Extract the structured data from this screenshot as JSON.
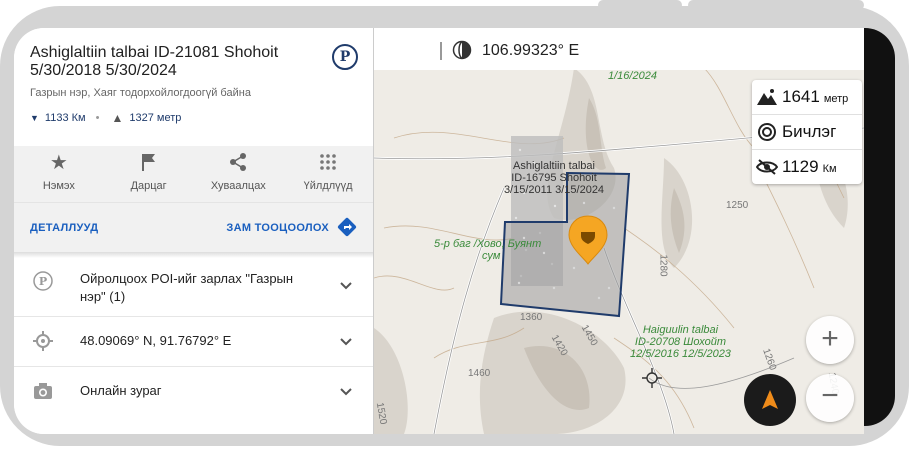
{
  "poi": {
    "title": "Ashiglaltiin talbai ID-21081 Shohoit 5/30/2018 5/30/2024",
    "subtitle": "Газрын нэр, Хаяг тодорхойлогдоогүй байна",
    "distance": "1133 Км",
    "elevation": "1327 метр",
    "badge": "P"
  },
  "actions": [
    {
      "label": "Нэмэх",
      "icon": "star-icon"
    },
    {
      "label": "Дарцаг",
      "icon": "flag-icon"
    },
    {
      "label": "Хуваалцах",
      "icon": "share-icon"
    },
    {
      "label": "Үйлдлүүд",
      "icon": "grid-dots-icon"
    }
  ],
  "links": {
    "details": "ДЕТАЛЛУУД",
    "route": "ЗАМ ТООЦООЛОХ"
  },
  "rows": [
    {
      "text": "Ойролцоох POI-ийг зарлах \"Газрын нэр\" (1)",
      "icon": "parking-poi-icon"
    },
    {
      "text": "48.09069° N, 91.76792° E",
      "icon": "location-target-icon"
    },
    {
      "text": "Онлайн зураг",
      "icon": "camera-icon"
    }
  ],
  "map": {
    "longitude": "106.99323° E",
    "info": {
      "altitude_value": "1641",
      "altitude_unit": "метр",
      "mode": "Бичлэг",
      "visibility_value": "1129",
      "visibility_unit": "Км"
    },
    "labels": {
      "date_top": "1/16/2024",
      "area_name": "Ashiglaltiin talbai",
      "area_id": "ID-16795 Shohoit",
      "area_dates": "3/15/2011 3/15/2024",
      "bag_line1": "5-р баг /Хово, Буянт",
      "bag_line2": "сум",
      "hai_line1": "Haiguulin talbai",
      "hai_line2": "ID-20708 Шохойт",
      "hai_line3": "12/5/2016 12/5/2023",
      "c1250a": "1250",
      "c1280": "1280",
      "c1250b": "1250",
      "c1260": "1260",
      "c1360": "1360",
      "c1420": "1420",
      "c1450": "1450",
      "c1460": "1460",
      "c1520": "1520",
      "c1240": "1240"
    },
    "zoom_in": "+",
    "zoom_out": "−"
  },
  "colors": {
    "accent": "#1a5fbf",
    "marker": "#f5a623",
    "polygon": "#1f3b6b",
    "green_label": "#3a8a3a"
  }
}
